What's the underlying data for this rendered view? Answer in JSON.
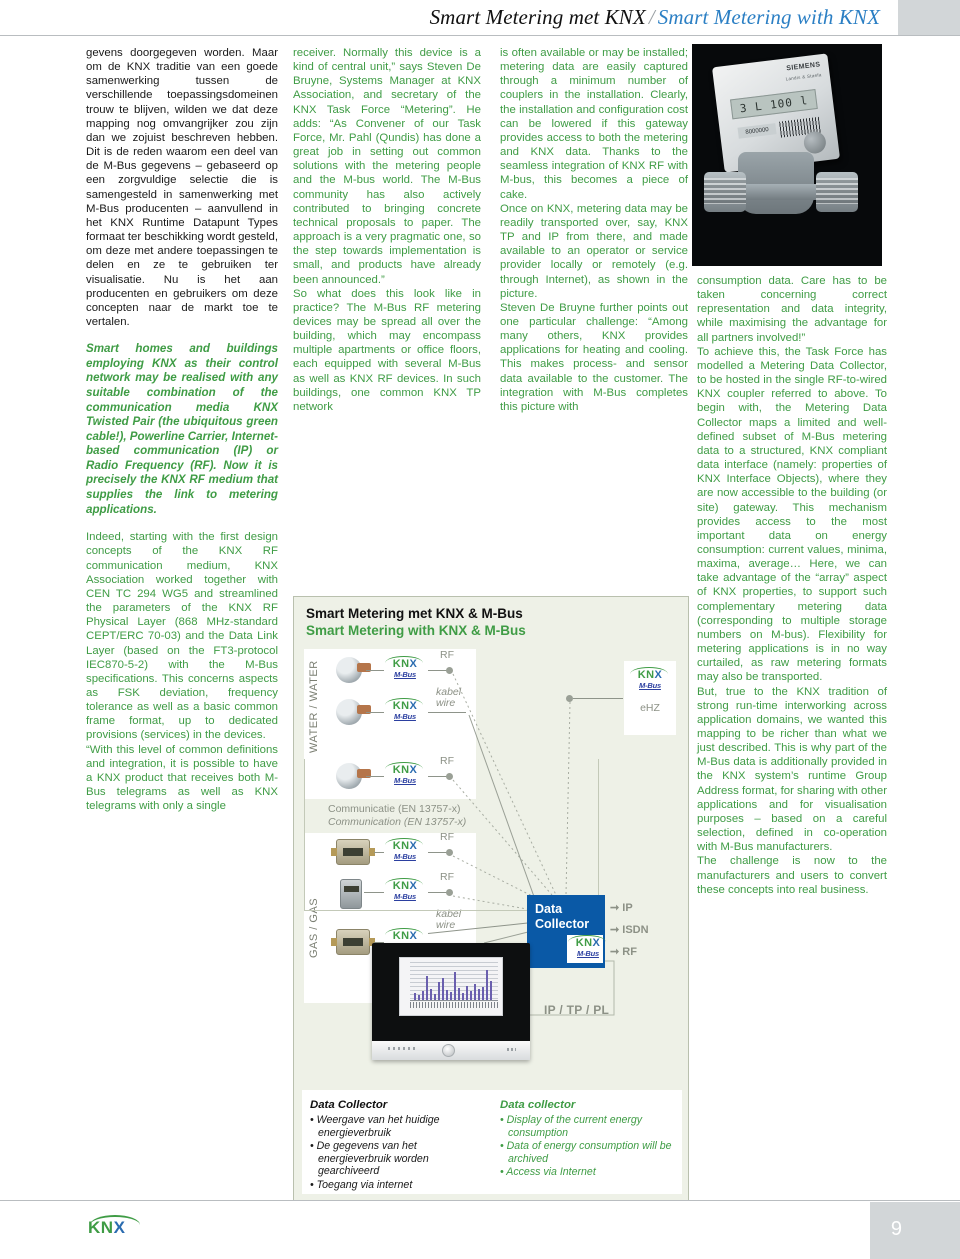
{
  "header": {
    "title_nl": "Smart Metering met KNX",
    "separator": "/",
    "title_en": "Smart Metering with KNX"
  },
  "columns": {
    "col1": {
      "p1": "gevens doorgegeven worden. Maar om de KNX traditie van een goede samenwerking tussen de verschillende toepassingsdomeinen trouw te blijven, wilden we dat deze mapping nog omvangrijker zou zijn dan we zojuist beschreven hebben. Dit is de reden waarom een deel van de M-Bus gegevens – gebaseerd op een zorgvuldige selectie die is samengesteld in samenwerking met M-Bus producenten – aanvullend in het KNX Runtime Datapunt Types formaat ter beschikking wordt gesteld, om deze met andere toepassingen te delen en ze te gebruiken ter visualisatie. Nu is het aan producenten en gebruikers om deze concepten naar de markt toe te vertalen.",
      "lead": "Smart homes and buildings employing KNX as their control network may be realised with any suitable combination of the communication media KNX Twisted Pair (the ubiquitous green cable!), Powerline Carrier, Internet-based communication (IP) or Radio Frequency (RF). Now it is precisely the KNX RF medium that supplies the link to metering applications.",
      "p2": "Indeed, starting with the first design concepts of the KNX RF communication medium, KNX Association worked together with CEN TC 294 WG5 and streamlined the parameters of the KNX RF Physical Layer (868 MHz-standard CEPT/ERC 70-03) and the Data Link Layer (based on the FT3-protocol IEC870-5-2) with the M-Bus specifications. This concerns aspects as FSK deviation, frequency tolerance as well as a basic common frame format, up to dedicated provisions (services) in the devices.",
      "p3": "“With this level of common definitions and integration, it is possible to have a KNX product that receives both M-Bus telegrams as well as KNX telegrams with only a single"
    },
    "col2": {
      "p1": "receiver. Normally this device is a kind of central unit,” says Steven De Bruyne, Systems Manager at KNX Association, and secretary of the KNX Task Force “Metering”. He adds: “As Convener of our Task Force, Mr. Pahl (Qundis) has done a great job in setting out common solutions with the metering people and the M-bus world. The M-Bus community has also actively contributed to bringing concrete technical proposals to paper. The approach is a very pragmatic one, so the step towards implementation is small, and products have already been announced.”",
      "p2": "So what does this look like in practice? The M-Bus RF metering devices may be spread all over the building, which may encompass multiple apartments or office floors, each equipped with several M-Bus as well as KNX RF devices. In such buildings, one common KNX TP network"
    },
    "col3": {
      "p1": "is often available or may be installed; metering data are easily captured through a minimum number of couplers in the installation. Clearly, the installation and configuration cost can be lowered if this gateway provides access to both the metering and KNX data. Thanks to the seamless integration of KNX RF with M-bus, this becomes a piece of cake.",
      "p2": "Once on KNX, metering data may be readily transported over, say, KNX TP and IP from there, and made available to an operator or service provider locally or remotely (e.g. through Internet), as shown in the picture.",
      "p3": "Steven De Bruyne further points out one particular challenge: “Among many others, KNX provides applications for heating and cooling. This makes process- and sensor data available to the customer. The integration with M-Bus completes this picture with"
    },
    "col4": {
      "p1": "consumption data. Care has to be taken concerning correct representation and data integrity, while maximising the advantage for all partners involved!”",
      "p2": "To achieve this, the Task Force has modelled a Metering Data Collector, to be hosted in the single RF-to-wired KNX coupler referred to above. To begin with, the Metering Data Collector maps a limited and well-defined subset of M-Bus metering data to a structured, KNX compliant data interface (namely: properties of KNX Interface Objects), where they are now accessible to the building (or site) gateway. This mechanism provides access to the most important data on energy consumption: current values, minima, maxima, average… Here, we can take advantage of the “array” aspect of KNX properties, to support such complementary metering data (corresponding to multiple storage numbers on M-bus). Flexibility for metering applications is in no way curtailed, as raw metering formats may also be transported.",
      "p3": "But, true to the KNX tradition of strong run-time interworking across application domains, we wanted this mapping to be richer than what we just described. This is why part of the M-Bus data is additionally provided in the KNX system’s runtime Group Address format, for sharing with other applications and for visualisation purposes – based on a careful selection, defined in co-operation with M-Bus manufacturers.",
      "p4": "The challenge is now to the manufacturers and users to convert these concepts into real business."
    }
  },
  "photo": {
    "brand": "SIEMENS",
    "sub": "Landis & Staefa",
    "lcd_value": "3 L 100 l",
    "serial": "8000000"
  },
  "diagram": {
    "title_nl": "Smart Metering met KNX & M-Bus",
    "title_en": "Smart Metering with KNX & M-Bus",
    "vertical_label_water": "WATER / WATER",
    "vertical_label_gas": "GAS / GAS",
    "knx_logo_text": "KNX",
    "mbus_logo_text": "M-Bus",
    "rf_label": "RF",
    "wire_label_nl": "kabel",
    "wire_label_en": "wire",
    "comm_nl": "Communicatie (EN 13757-x)",
    "comm_en": "Communication (EN 13757-x)",
    "ehz_label": "eHZ",
    "data_collector_line1": "Data",
    "data_collector_line2": "Collector",
    "outputs": [
      "IP",
      "ISDN",
      "RF"
    ],
    "ip_tp_pl": "IP / TP / PL",
    "caption_nl": {
      "heading": "Data Collector",
      "items": [
        "Weergave van het huidige energieverbruik",
        "De gegevens van het energieverbruik worden gearchiveerd",
        "Toegang via internet"
      ]
    },
    "caption_en": {
      "heading": "Data collector",
      "items": [
        "Display of the current energy consumption",
        "Data of energy consumption will be archived",
        "Access via Internet"
      ]
    }
  },
  "footer": {
    "logo_text": "KNX",
    "page_number": "9"
  },
  "colors": {
    "body_green": "#3f9c45",
    "header_blue": "#2b7fc4",
    "logo_blue": "#2b6cb0",
    "collector_blue": "#0a59a6",
    "panel_bg": "#eef1e7",
    "tab_grey": "#d2d6d8"
  }
}
